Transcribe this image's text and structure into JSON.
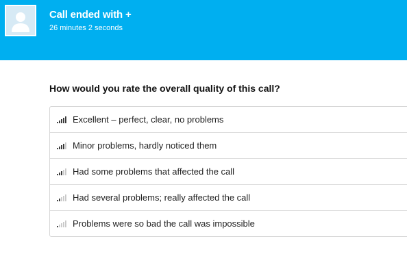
{
  "header": {
    "title": "Call ended with +",
    "duration": "26 minutes 2 seconds",
    "background_color": "#00aff0",
    "avatar_icon": "user-silhouette-icon"
  },
  "survey": {
    "question": "How would you rate the overall quality of this call?",
    "options": [
      {
        "label": "Excellent – perfect, clear, no problems",
        "icon": "signal-bars-icon",
        "signal_level": 5
      },
      {
        "label": "Minor problems, hardly noticed them",
        "icon": "signal-bars-icon",
        "signal_level": 4
      },
      {
        "label": "Had some problems that affected the call",
        "icon": "signal-bars-icon",
        "signal_level": 3
      },
      {
        "label": "Had several problems; really affected the call",
        "icon": "signal-bars-icon",
        "signal_level": 2
      },
      {
        "label": "Problems were so bad the call was impossible",
        "icon": "signal-bars-icon",
        "signal_level": 1
      }
    ],
    "bar_colors": {
      "active": "#333333",
      "inactive": "#c8c8c8"
    }
  }
}
